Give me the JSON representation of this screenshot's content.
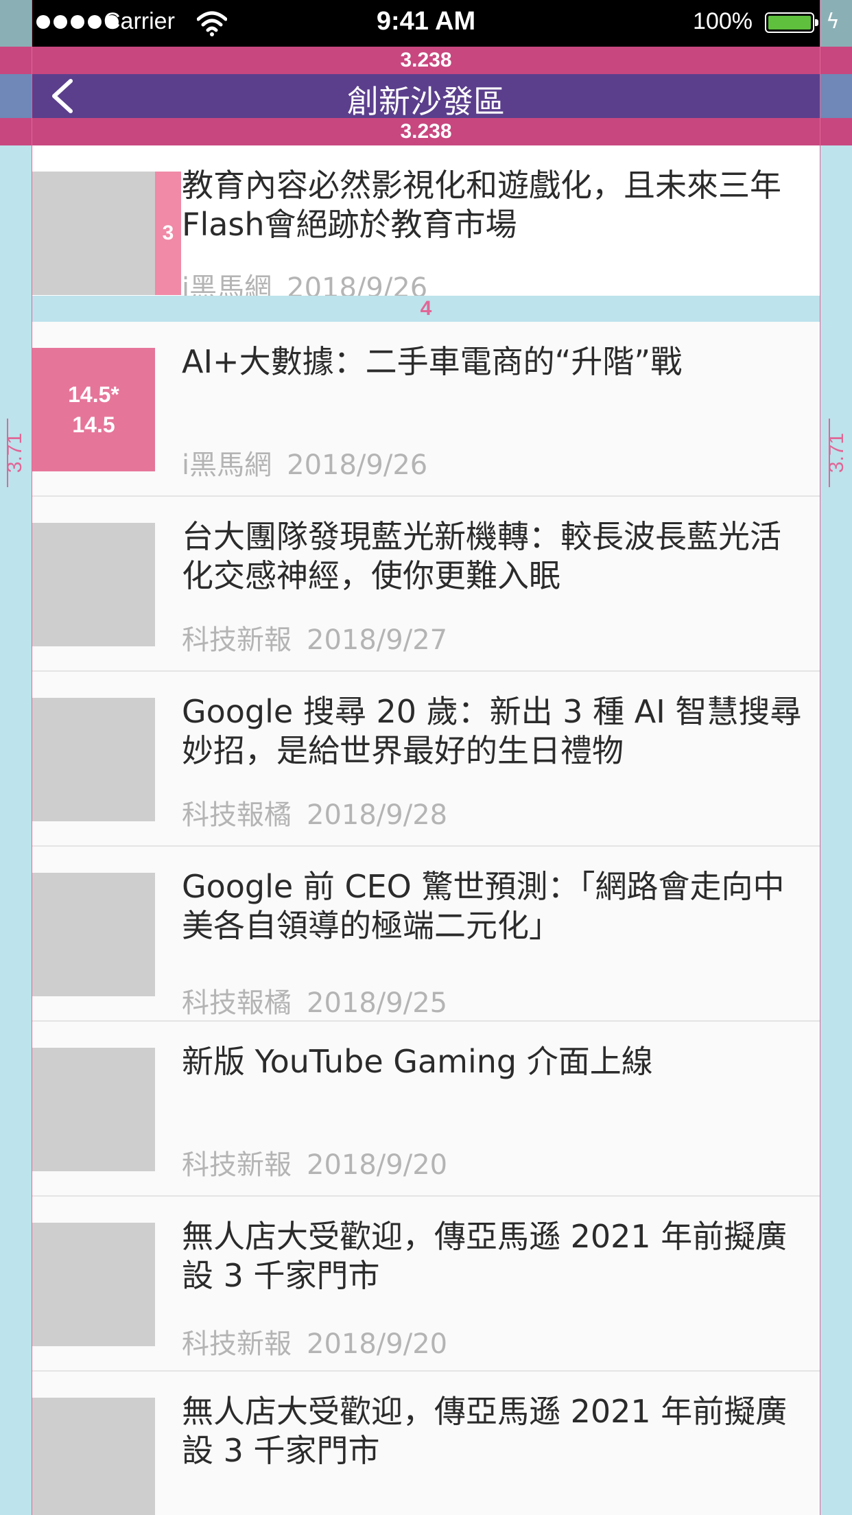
{
  "colors": {
    "guide": "#bde3ec",
    "magenta": "#c8477f",
    "nav": "#5b3f8c",
    "thumb": "#cecece",
    "highlight": "#e6759a",
    "guide_line": "#e06797"
  },
  "status_bar": {
    "carrier": "Carrier",
    "time": "9:41 AM",
    "battery": "100%"
  },
  "nav": {
    "spacing_top": "3.238",
    "title": "創新沙發區",
    "spacing_bottom": "3.238",
    "back_icon": "chevron-left-icon"
  },
  "annotations": {
    "top_gap": "4",
    "bottom_gap": "4",
    "side_left": "3.71",
    "side_right": "3.71",
    "title_spacer": "3",
    "thumb_size": [
      "14.5*",
      "14.5"
    ]
  },
  "articles": [
    {
      "title": "教育內容必然影視化和遊戲化，且未來三年Flash會絕跡於教育市場",
      "source": "i黑馬網",
      "date": "2018/9/26"
    },
    {
      "title": "AI+大數據：二手車電商的“升階”戰",
      "source": "i黑馬網",
      "date": "2018/9/26"
    },
    {
      "title": "台大團隊發現藍光新機轉：較長波長藍光活化交感神經，使你更難入眠",
      "source": "科技新報",
      "date": "2018/9/27"
    },
    {
      "title": "Google 搜尋 20 歲：新出 3 種 AI 智慧搜尋妙招，是給世界最好的生日禮物",
      "source": "科技報橘",
      "date": "2018/9/28"
    },
    {
      "title": "Google 前 CEO 驚世預測：「網路會走向中美各自領導的極端二元化」",
      "source": "科技報橘",
      "date": "2018/9/25"
    },
    {
      "title": "新版 YouTube Gaming 介面上線",
      "source": "科技新報",
      "date": "2018/9/20"
    },
    {
      "title": "無人店大受歡迎，傳亞馬遜 2021 年前擬廣設 3 千家門市",
      "source": "科技新報",
      "date": "2018/9/20"
    },
    {
      "title": "無人店大受歡迎，傳亞馬遜 2021 年前擬廣設 3 千家門市",
      "source": "",
      "date": ""
    }
  ]
}
